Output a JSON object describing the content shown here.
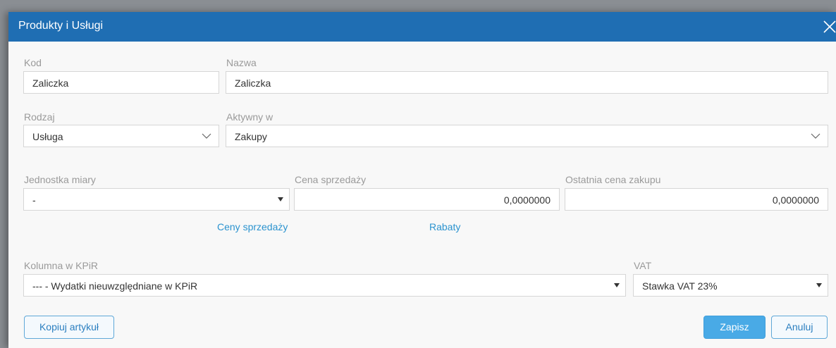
{
  "dialog": {
    "title": "Produkty i Usługi"
  },
  "form": {
    "kod": {
      "label": "Kod",
      "value": "Zaliczka"
    },
    "nazwa": {
      "label": "Nazwa",
      "value": "Zaliczka"
    },
    "rodzaj": {
      "label": "Rodzaj",
      "value": "Usługa"
    },
    "aktywny_w": {
      "label": "Aktywny w",
      "value": "Zakupy"
    },
    "jednostka_miary": {
      "label": "Jednostka miary",
      "value": "-"
    },
    "cena_sprzedazy": {
      "label": "Cena sprzedaży",
      "value": "0,0000000"
    },
    "ostatnia_cena_zakupu": {
      "label": "Ostatnia cena zakupu",
      "value": "0,0000000"
    },
    "kolumna_kpir": {
      "label": "Kolumna w KPiR",
      "value": "--- - Wydatki nieuwzględniane w KPiR"
    },
    "vat": {
      "label": "VAT",
      "value": "Stawka VAT 23%"
    }
  },
  "links": {
    "ceny_sprzedazy": "Ceny sprzedaży",
    "rabaty": "Rabaty"
  },
  "buttons": {
    "kopiuj": "Kopiuj artykuł",
    "zapisz": "Zapisz",
    "anuluj": "Anuluj"
  },
  "icons": {
    "close": "close-icon",
    "chevron": "chevron-down-icon",
    "caret": "caret-down-icon"
  },
  "colors": {
    "titlebar": "#1f6eb3",
    "link": "#2b93cf",
    "primary_button": "#49aae6"
  }
}
